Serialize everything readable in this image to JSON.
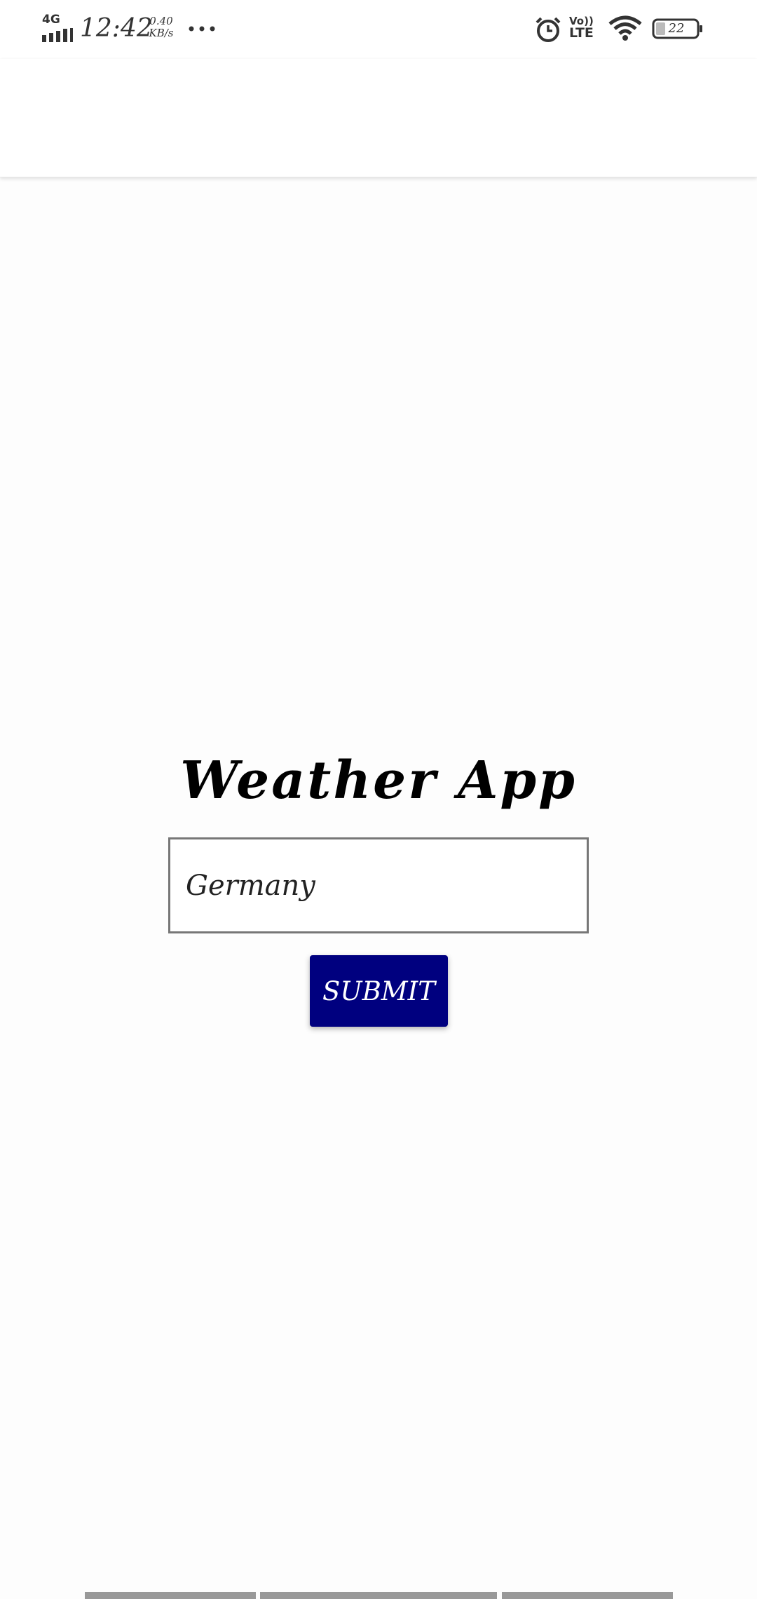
{
  "status_bar": {
    "network_type": "4G",
    "time": "12:42",
    "speed_value": "0.40",
    "speed_unit": "KB/s",
    "volte_top": "Vo))",
    "volte_bottom": "LTE",
    "battery_level": "22"
  },
  "app": {
    "title": "Weather App",
    "city_input_value": "Germany",
    "submit_label": "SUBMIT"
  },
  "colors": {
    "submit_button": "#00007f",
    "background": "#fdfdfd"
  },
  "icons": [
    "signal-icon",
    "more-dots-icon",
    "alarm-icon",
    "wifi-icon",
    "battery-icon"
  ]
}
